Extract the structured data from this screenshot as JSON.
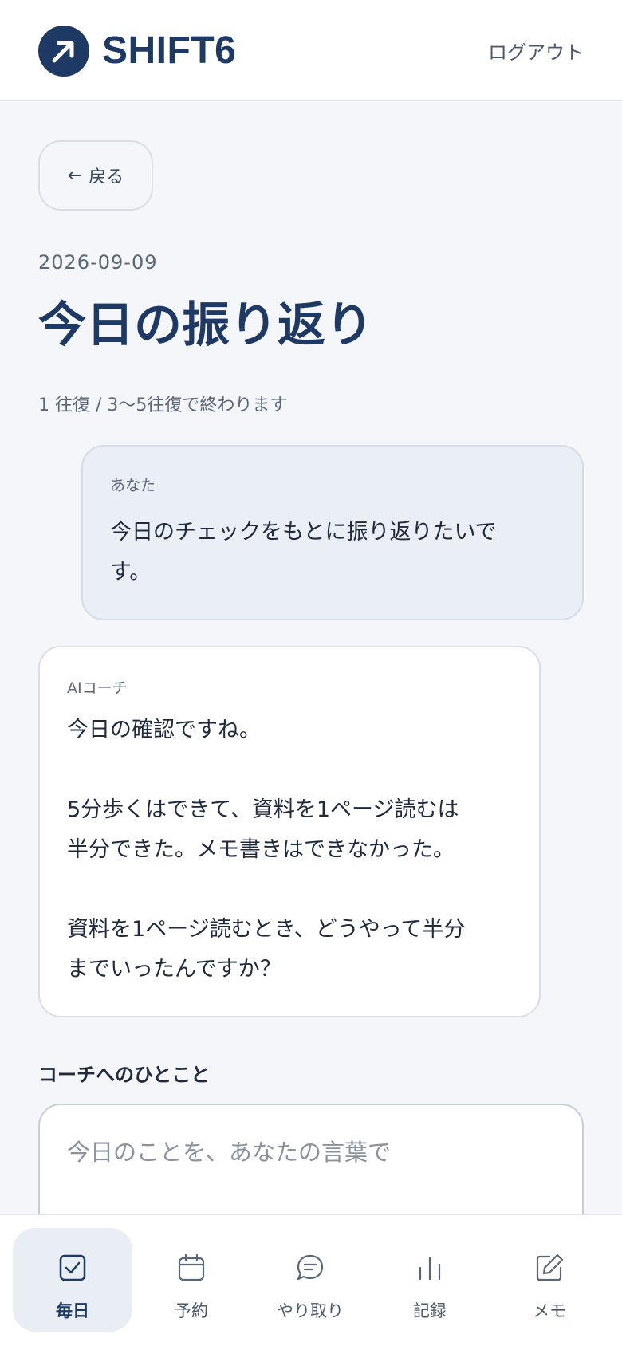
{
  "header": {
    "logo_text": "SHIFT6",
    "logout_label": "ログアウト"
  },
  "back": {
    "arrow": "←",
    "label": "戻る"
  },
  "session": {
    "date": "2026-09-09",
    "title": "今日の振り返り",
    "progress": "1 往復 / 3〜5往復で終わります"
  },
  "messages": [
    {
      "speaker": "あなた",
      "text": "今日のチェックをもとに振り返りたいで\nす。"
    },
    {
      "speaker": "AIコーチ",
      "text": "今日の確認ですね。\n\n5分歩くはできて、資料を1ページ読むは\n半分できた。メモ書きはできなかった。\n\n資料を1ページ読むとき、どうやって半分\nまでいったんですか？"
    }
  ],
  "reply": {
    "label": "コーチへのひとこと",
    "placeholder": "今日のことを、あなたの言葉で",
    "value": ""
  },
  "tabs": [
    {
      "label": "毎日",
      "icon": "checkbox-icon",
      "active": true
    },
    {
      "label": "予約",
      "icon": "calendar-icon",
      "active": false
    },
    {
      "label": "やり取り",
      "icon": "chat-bubble-icon",
      "active": false
    },
    {
      "label": "記録",
      "icon": "bar-chart-icon",
      "active": false
    },
    {
      "label": "メモ",
      "icon": "edit-note-icon",
      "active": false
    }
  ],
  "colors": {
    "brand": "#1e3a64",
    "background": "#f4f6f9",
    "user_bubble": "#eaeff5",
    "active_tab": "#e9eef4"
  }
}
